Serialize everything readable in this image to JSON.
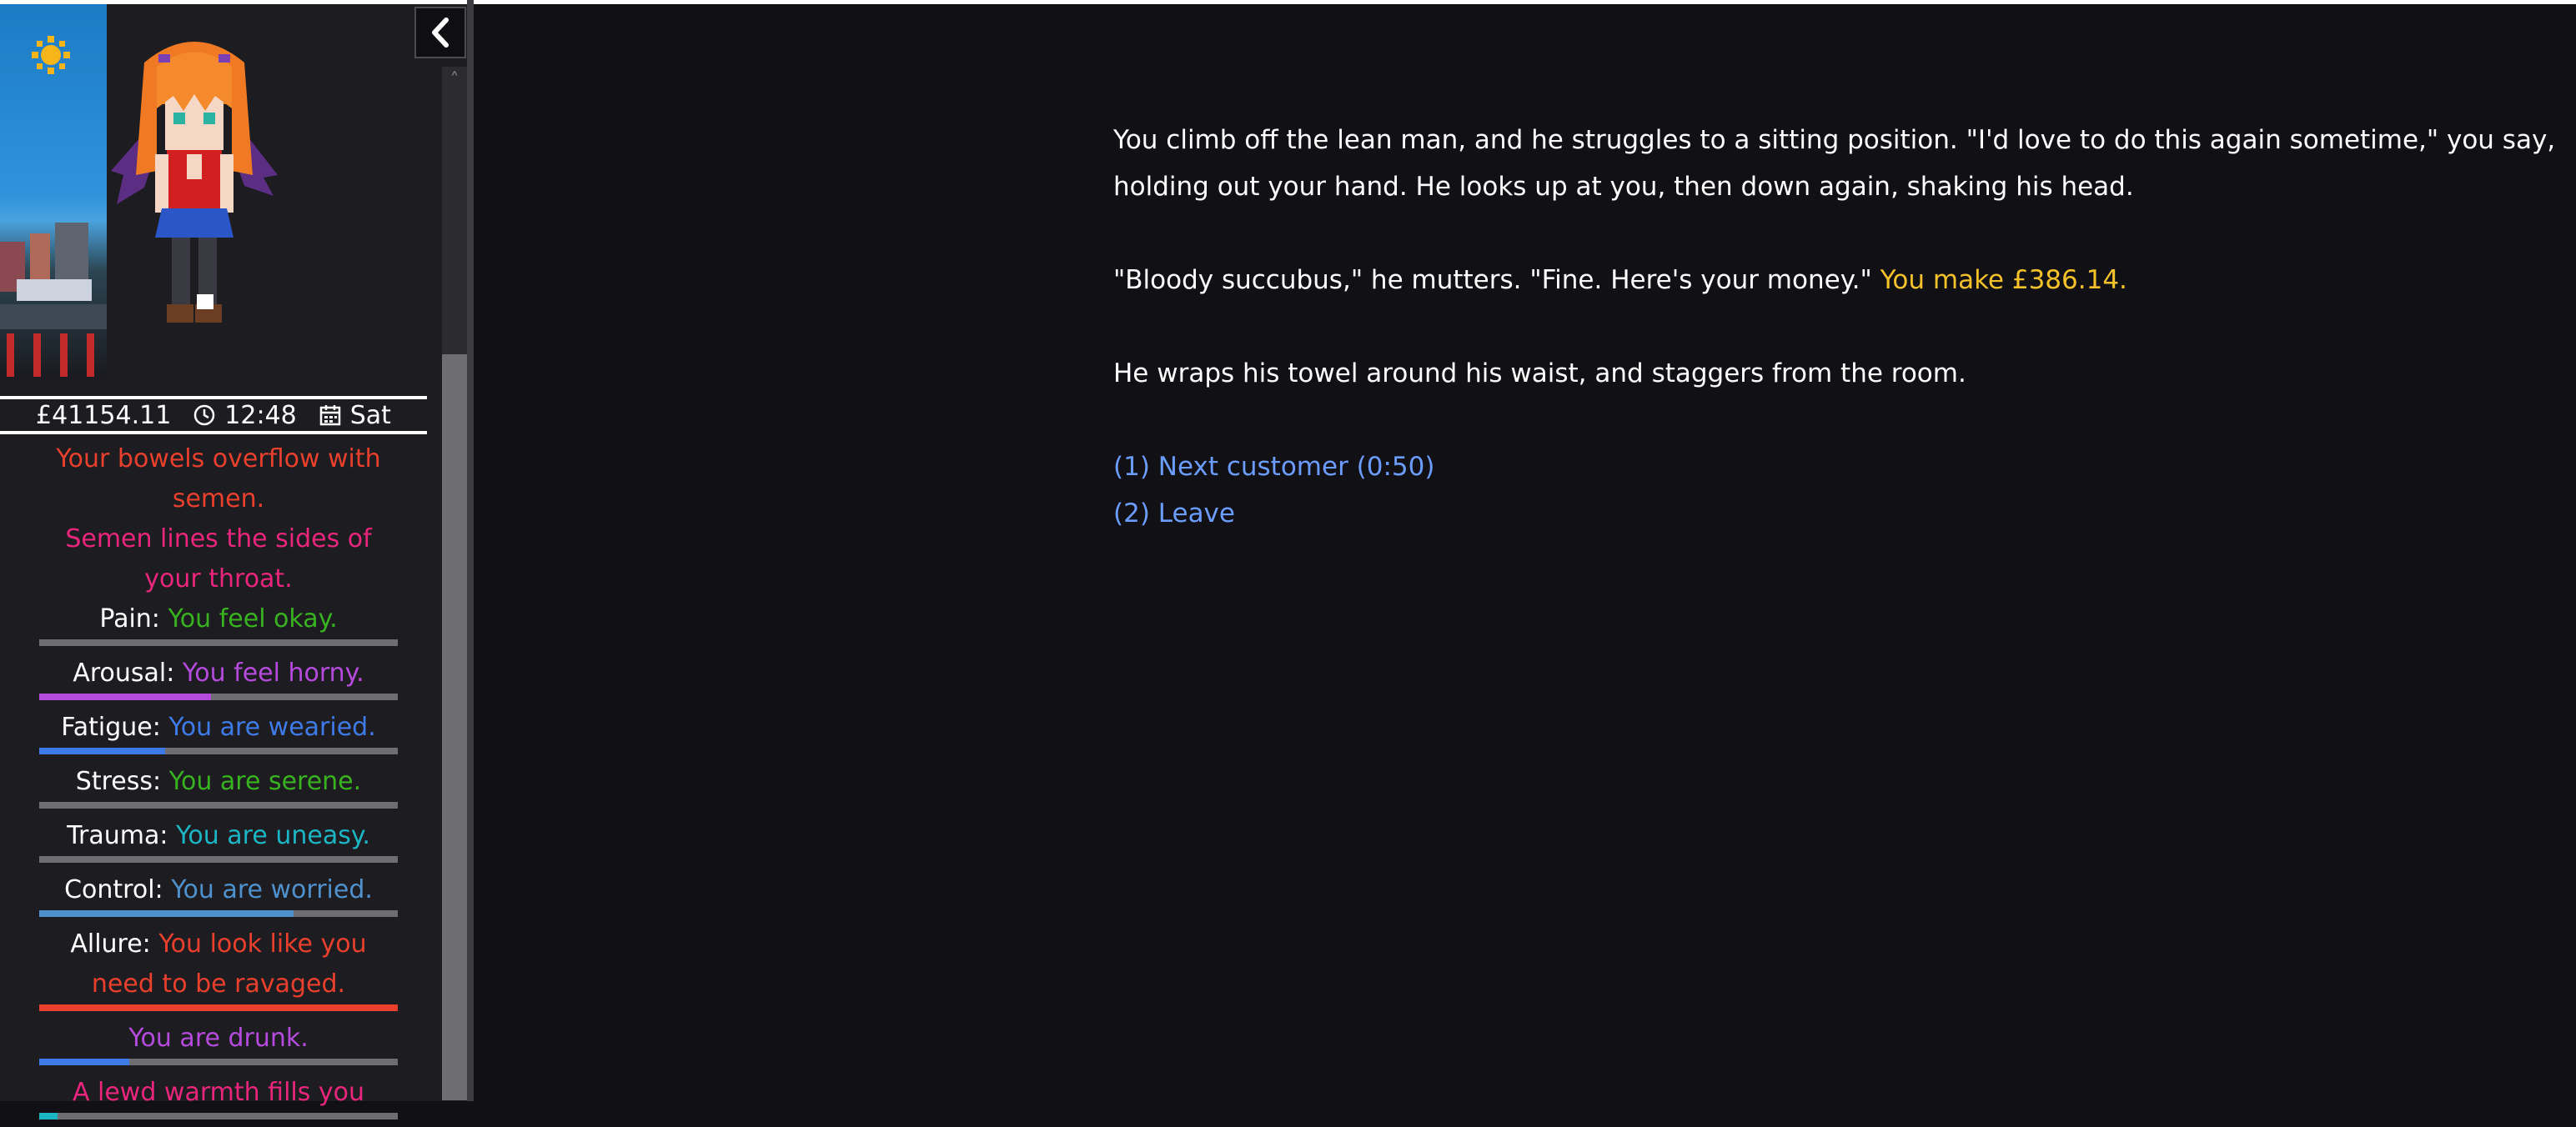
{
  "status": {
    "money": "£41154.11",
    "time": "12:48",
    "day": "Sat"
  },
  "messages": [
    {
      "text": "Your bowels overflow with semen.",
      "color": "#e8402d"
    },
    {
      "text": "Semen lines the sides of your throat.",
      "color": "#e9267c"
    }
  ],
  "stats": [
    {
      "label": "Pain:",
      "value": "You feel okay.",
      "fill": 0.0,
      "color": "#39b220"
    },
    {
      "label": "Arousal:",
      "value": "You feel horny.",
      "fill": 0.48,
      "color": "#b54bdc"
    },
    {
      "label": "Fatigue:",
      "value": "You are wearied.",
      "fill": 0.35,
      "color": "#3e7be8"
    },
    {
      "label": "Stress:",
      "value": "You are serene.",
      "fill": 0.0,
      "color": "#39b220"
    },
    {
      "label": "Trauma:",
      "value": "You are uneasy.",
      "fill": 0.0,
      "color": "#1cb5c4"
    },
    {
      "label": "Control:",
      "value": "You are worried.",
      "fill": 0.71,
      "color": "#4e91cc"
    },
    {
      "label": "Allure:",
      "value": "You look like you need to be ravaged.",
      "fill": 1.0,
      "color": "#e8402d"
    }
  ],
  "extra_status": [
    {
      "value": "You are drunk.",
      "fill": 0.25,
      "color": "#b54bdc",
      "bar_color": "#3e7be8"
    },
    {
      "value": "A lewd warmth fills you",
      "fill": 0.05,
      "color": "#e9267c",
      "bar_color": "#1cb5c4"
    }
  ],
  "story": {
    "p1": "You climb off the lean man, and he struggles to a sitting position. \"I'd love to do this again sometime,\" you say, holding out your hand. He looks up at you, then down again, shaking his head.",
    "p2_text": "\"Bloody succubus,\" he mutters. \"Fine. Here's your money.\"",
    "p2_money": "You make £386.14.",
    "p3": "He wraps his towel around his waist, and staggers from the room."
  },
  "choices": [
    {
      "label": "(1) Next customer (0:50)"
    },
    {
      "label": "(2) Leave"
    }
  ],
  "icons": {
    "sun": "sun-icon",
    "clock": "clock-icon",
    "calendar": "calendar-icon",
    "collapse": "chevron-left-icon"
  },
  "colors": {
    "background": "#111014",
    "sidebar": "#1d1c21",
    "link": "#6b9cff",
    "money": "#f5c229"
  }
}
